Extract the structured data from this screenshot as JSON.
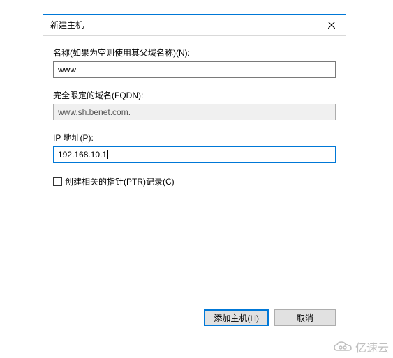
{
  "dialog": {
    "title": "新建主机",
    "close_icon": "close"
  },
  "fields": {
    "name": {
      "label": "名称(如果为空则使用其父域名称)(N):",
      "value": "www"
    },
    "fqdn": {
      "label": "完全限定的域名(FQDN):",
      "value": "www.sh.benet.com."
    },
    "ip": {
      "label": "IP 地址(P):",
      "value": "192.168.10.1"
    },
    "ptr_checkbox": {
      "label": "创建相关的指针(PTR)记录(C)",
      "checked": false
    }
  },
  "buttons": {
    "add_host": "添加主机(H)",
    "cancel": "取消"
  },
  "watermark": {
    "text": "亿速云"
  }
}
